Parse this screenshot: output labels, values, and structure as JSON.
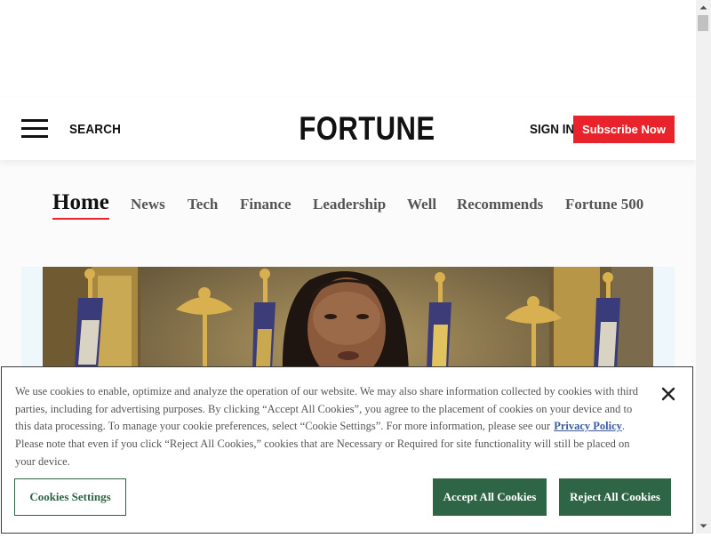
{
  "header": {
    "search_label": "SEARCH",
    "logo": "FORTUNE",
    "signin_label": "SIGN IN",
    "subscribe_label": "Subscribe Now",
    "subscribe_color": "#e8232c"
  },
  "nav": {
    "items": [
      {
        "label": "Home",
        "active": true
      },
      {
        "label": "News"
      },
      {
        "label": "Tech"
      },
      {
        "label": "Finance"
      },
      {
        "label": "Leadership"
      },
      {
        "label": "Well"
      },
      {
        "label": "Recommends"
      },
      {
        "label": "Fortune 500"
      }
    ]
  },
  "cookie_banner": {
    "text_before_link": "We use cookies to enable, optimize and analyze the operation of our website. We may also share information collected by cookies with third parties, including for advertising purposes. By clicking “Accept All Cookies”, you agree to the placement of cookies on your device and to this data processing. To manage your cookie preferences, select “Cookie Settings”. For more information, please see our",
    "privacy_link": "Privacy Policy",
    "text_after_link": ". Please note that even if you click “Reject All Cookies,” cookies that are Necessary or Required for site functionality will still be placed on your device.",
    "settings_label": "Cookies Settings",
    "accept_label": "Accept All Cookies",
    "reject_label": "Reject All Cookies",
    "button_color": "#2e6546",
    "link_color": "#3b5c9c"
  },
  "icons": {
    "menu": "hamburger-icon",
    "close": "close-icon",
    "scroll_up": "arrow-up-icon",
    "scroll_down": "arrow-down-icon"
  }
}
